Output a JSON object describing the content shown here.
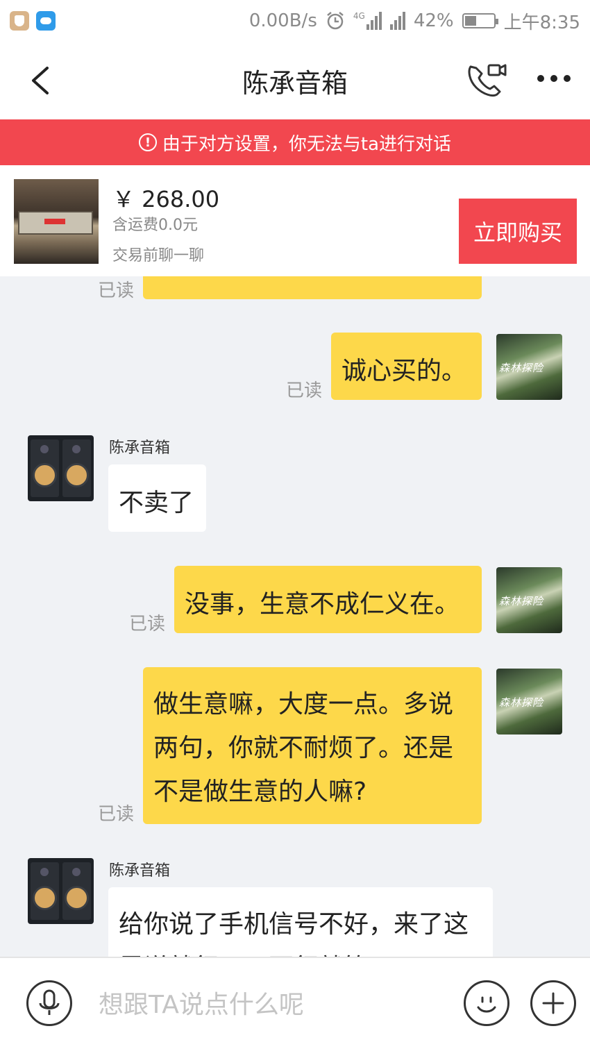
{
  "status_bar": {
    "net_speed": "0.00B/s",
    "network_label": "4G",
    "battery": "42%",
    "battery_level": 0.42,
    "time": "上午8:35"
  },
  "header": {
    "title": "陈承音箱"
  },
  "banner": {
    "icon": "!",
    "text": "由于对方设置，你无法与ta进行对话"
  },
  "product": {
    "price": "￥ 268.00",
    "shipping": "含运费0.0元",
    "note": "交易前聊一聊",
    "buy_label": "立即购买"
  },
  "messages": [
    {
      "side": "me",
      "text": "",
      "status": "已读"
    },
    {
      "side": "me",
      "text": "诚心买的。",
      "status": "已读"
    },
    {
      "side": "other",
      "sender": "陈承音箱",
      "text": "不卖了"
    },
    {
      "side": "me",
      "text": "没事，生意不成仁义在。",
      "status": "已读"
    },
    {
      "side": "me",
      "text": "做生意嘛，大度一点。多说两句，你就不耐烦了。还是不是做生意的人嘛?",
      "status": "已读"
    },
    {
      "side": "other",
      "sender": "陈承音箱",
      "text": "给你说了手机信号不好，来了这里说就行，一百行就算了"
    }
  ],
  "input": {
    "placeholder": "想跟TA说点什么呢"
  },
  "avatar_me_text": "森林探险",
  "colors": {
    "banner": "#f2474f",
    "my_bubble": "#fdd84a",
    "buy_button": "#f2474f"
  }
}
